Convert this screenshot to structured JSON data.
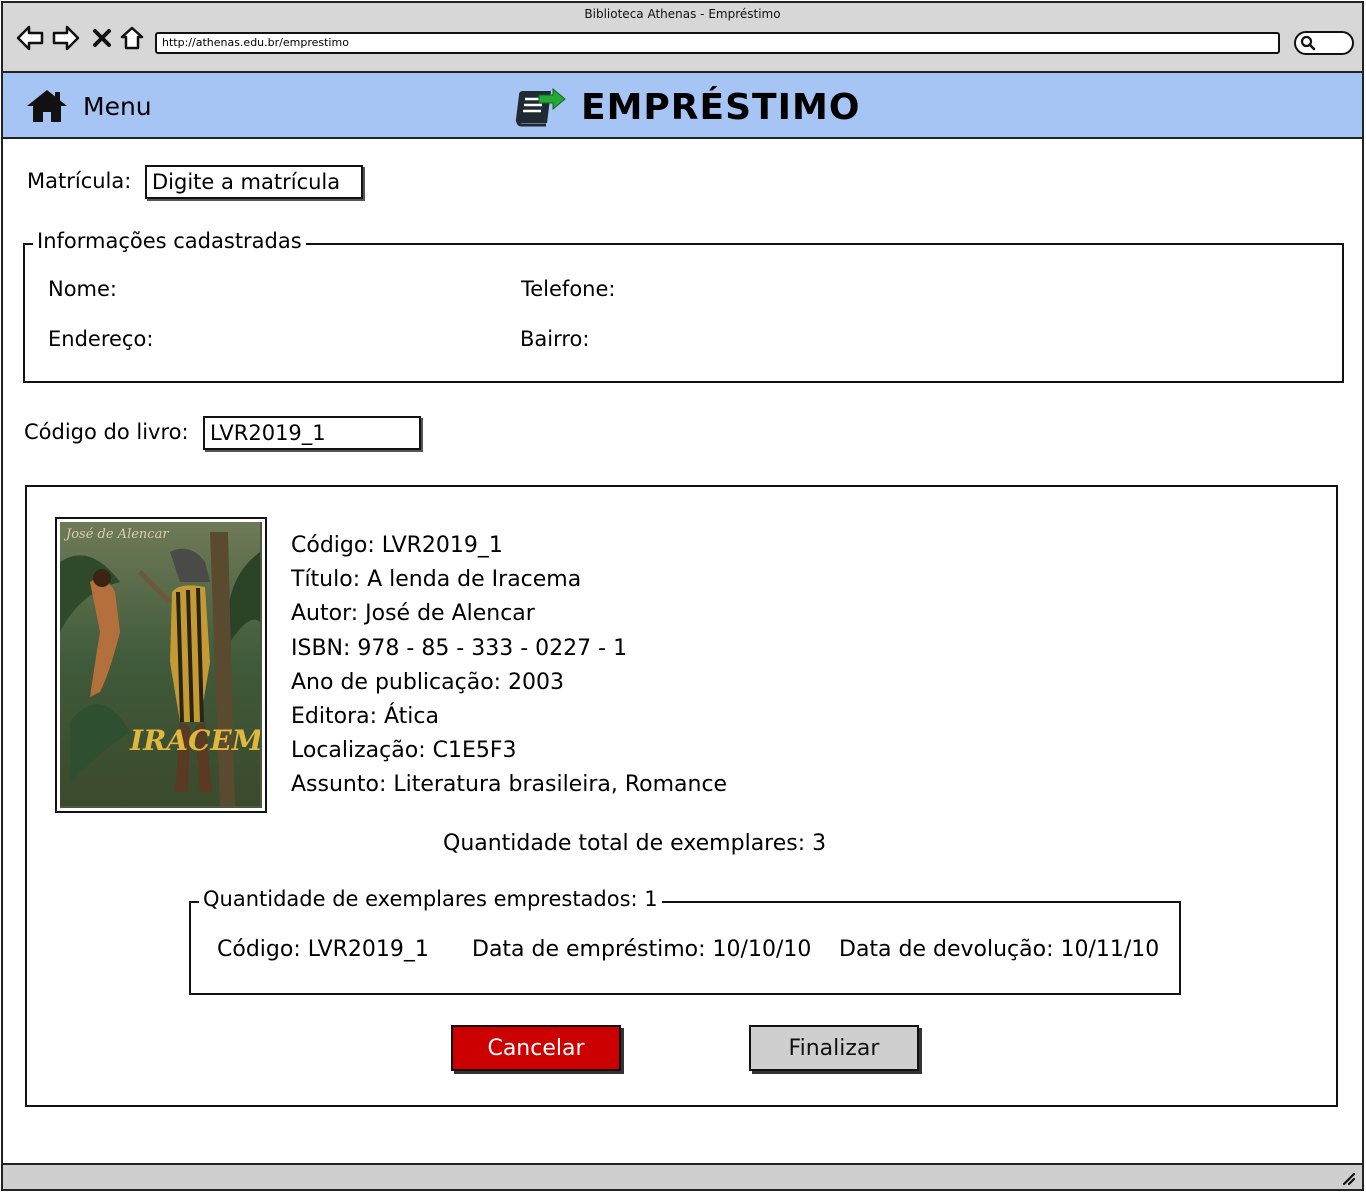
{
  "window": {
    "title": "Biblioteca Athenas - Empréstimo",
    "url": "http://athenas.edu.br/emprestimo"
  },
  "header": {
    "menu_label": "Menu",
    "title": "EMPRÉSTIMO",
    "accent_color": "#a6c5f4"
  },
  "form": {
    "matricula_label": "Matrícula:",
    "matricula_value": "Digite a matrícula",
    "info_legend": "Informações cadastradas",
    "nome_label": "Nome:",
    "telefone_label": "Telefone:",
    "endereco_label": "Endereço:",
    "bairro_label": "Bairro:",
    "codigo_livro_label": "Código do livro:",
    "codigo_livro_value": "LVR2019_1"
  },
  "book": {
    "cover_author": "José de Alencar",
    "cover_title": "IRACEMA",
    "details": [
      "Código: LVR2019_1",
      "Título: A lenda de Iracema",
      "Autor: José de Alencar",
      "ISBN: 978 - 85 - 333 - 0227 - 1",
      "Ano de publicação: 2003",
      "Editora: Ática",
      "Localização: C1E5F3",
      "Assunto: Literatura brasileira, Romance"
    ],
    "total_copies": "Quantidade total de exemplares: 3"
  },
  "loans": {
    "legend": "Quantidade de exemplares emprestados: 1",
    "codigo": "Código: LVR2019_1",
    "data_emprestimo": "Data de empréstimo: 10/10/10",
    "data_devolucao": "Data de devolução: 10/11/10"
  },
  "actions": {
    "cancel_label": "Cancelar",
    "finish_label": "Finalizar",
    "cancel_color": "#cc0000"
  }
}
